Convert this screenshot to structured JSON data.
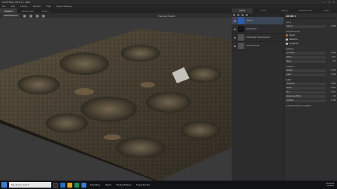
{
  "window": {
    "app_title": "Quixel Mixer 2021.1.4 - Beta",
    "controls": [
      "—",
      "□",
      "✕"
    ]
  },
  "menu": [
    "File",
    "Edit",
    "Library",
    "Window",
    "Help",
    "Export Settings"
  ],
  "viewport_tabs": [
    "Viewport",
    "Texture Sets",
    "Library"
  ],
  "viewport": {
    "shading_mode": "PBR Metalness",
    "document_name": "cherries_forest1"
  },
  "panel_tabs": [
    "Layers",
    "Mixer",
    "Display",
    "Displacement",
    "Export"
  ],
  "layers": [
    {
      "name": "Liquid 1",
      "thumb": "blue",
      "active": true
    },
    {
      "name": "Dusty Rock",
      "thumb": "dark",
      "active": false
    },
    {
      "name": "Untouched Forest Ground",
      "thumb": "gray",
      "active": false
    },
    {
      "name": "Ground Forest",
      "thumb": "gray",
      "active": false
    }
  ],
  "properties": {
    "title": "LIQUID 1",
    "sections": {
      "mode": "MODE",
      "mode_value": "Opacity",
      "mode_number": "0.500",
      "affected": "AFFECTED MAPS",
      "channels": [
        "Albedo",
        "Reflection",
        "Roughness"
      ],
      "channel_colors": [
        "#c27a2a",
        "#cfcfcf",
        "#cfcfcf"
      ],
      "surface": "SURFACE",
      "surface_rows": [
        {
          "label": "Thickness",
          "value": "0.300"
        },
        {
          "label": "Radius",
          "value": "0.01"
        },
        {
          "label": "Wave",
          "value": "0.0"
        }
      ],
      "turbidity": "TURBIDITY",
      "turbidity_rows": [
        {
          "label": "Surface",
          "value": "0.170"
        },
        {
          "label": "Depth",
          "value": "0.150"
        }
      ],
      "blend": "BLEND",
      "blend_rows": [
        {
          "label": "Threshold",
          "value": "0.500"
        },
        {
          "label": "Radius",
          "value": "0.027"
        },
        {
          "label": "Blur",
          "value": "0.010"
        },
        {
          "label": "Roughness Offset",
          "value": "0.0"
        },
        {
          "label": "Contrast",
          "value": "0.750"
        }
      ],
      "footer": "CUSTOM MASKING CHANNELS"
    }
  },
  "taskbar": {
    "search_placeholder": "Type here to search",
    "apps": [
      "Quixel Mixer",
      "Ubuntu",
      "Windows Explorer",
      "Screen Recorder"
    ],
    "time": "10:38 AM",
    "date": "7/4/2021"
  }
}
